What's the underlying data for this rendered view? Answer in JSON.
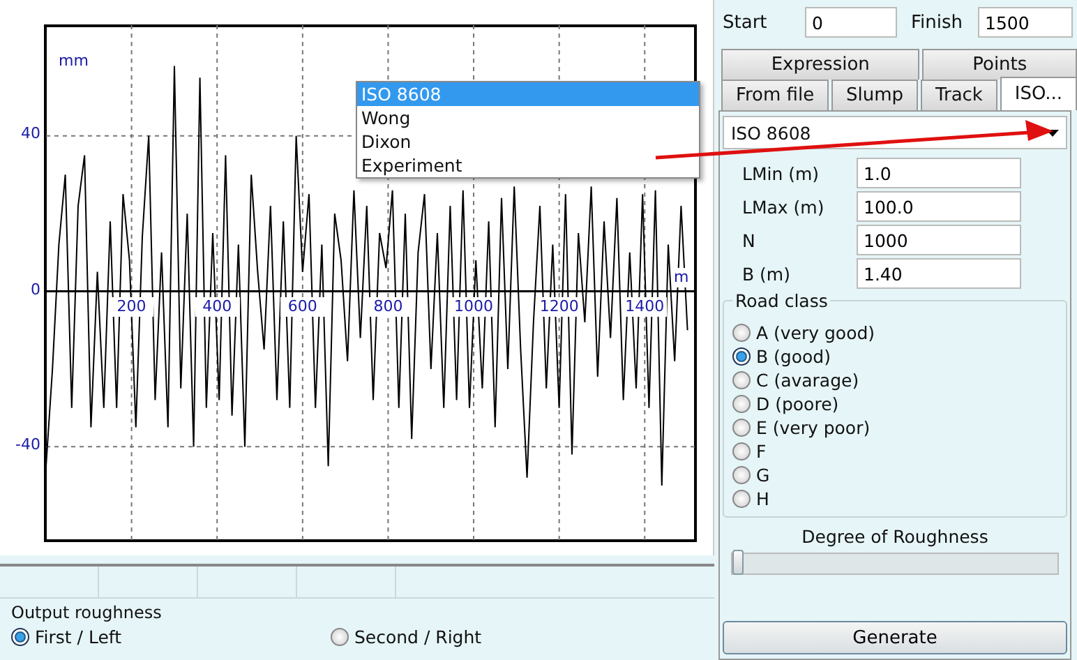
{
  "plot": {
    "chart_data": {
      "type": "line",
      "xlabel": "m",
      "ylabel": "mm",
      "grid": true,
      "xlim": [
        0,
        1517
      ],
      "ylim": [
        -64,
        68.5
      ],
      "xticks": [
        {
          "value": 200,
          "label": "200"
        },
        {
          "value": 400,
          "label": "400"
        },
        {
          "value": 600,
          "label": "600"
        },
        {
          "value": 800,
          "label": "800"
        },
        {
          "value": 1000,
          "label": "1000"
        },
        {
          "value": 1200,
          "label": "1200"
        },
        {
          "value": 1400,
          "label": "1400"
        }
      ],
      "yticks": [
        {
          "value": 40,
          "label": "40"
        },
        {
          "value": 0,
          "label": "0"
        },
        {
          "value": -40,
          "label": "-40"
        }
      ],
      "x": [
        0,
        15,
        30,
        45,
        60,
        75,
        90,
        105,
        120,
        135,
        150,
        165,
        180,
        195,
        210,
        225,
        240,
        255,
        270,
        285,
        300,
        315,
        330,
        345,
        360,
        375,
        390,
        405,
        420,
        435,
        450,
        465,
        480,
        495,
        510,
        525,
        540,
        555,
        570,
        585,
        600,
        615,
        630,
        645,
        660,
        675,
        690,
        705,
        720,
        735,
        750,
        765,
        780,
        795,
        810,
        825,
        840,
        855,
        870,
        885,
        900,
        915,
        930,
        945,
        960,
        975,
        990,
        1005,
        1020,
        1035,
        1050,
        1065,
        1080,
        1095,
        1110,
        1125,
        1140,
        1155,
        1170,
        1185,
        1200,
        1215,
        1230,
        1245,
        1260,
        1275,
        1290,
        1305,
        1320,
        1335,
        1350,
        1365,
        1380,
        1395,
        1410,
        1425,
        1440,
        1455,
        1470,
        1485,
        1500
      ],
      "values": [
        -45,
        -20,
        12,
        30,
        -30,
        22,
        35,
        -35,
        5,
        -30,
        18,
        -30,
        25,
        8,
        -35,
        14,
        40,
        -28,
        10,
        -35,
        58,
        -25,
        20,
        -40,
        55,
        -30,
        15,
        -28,
        35,
        -32,
        12,
        -40,
        30,
        5,
        -15,
        22,
        -28,
        18,
        -30,
        40,
        5,
        25,
        -30,
        12,
        -45,
        20,
        8,
        -18,
        26,
        -12,
        22,
        -28,
        15,
        6,
        26,
        -30,
        20,
        -38,
        10,
        25,
        -20,
        15,
        -30,
        22,
        -28,
        26,
        -30,
        8,
        -25,
        18,
        -35,
        24,
        -20,
        27,
        -15,
        -48,
        -8,
        22,
        -25,
        12,
        -30,
        25,
        -42,
        15,
        -8,
        27,
        -22,
        18,
        -12,
        24,
        -28,
        10,
        -25,
        25,
        -30,
        26,
        -50,
        12,
        -18,
        22,
        -10
      ]
    }
  },
  "output_roughness": {
    "title": "Output roughness",
    "options": [
      {
        "label": "First / Left",
        "selected": true
      },
      {
        "label": "Second / Right",
        "selected": false
      }
    ]
  },
  "range": {
    "start_label": "Start",
    "start": "0",
    "finish_label": "Finish",
    "finish": "1500"
  },
  "tabs": [
    [
      {
        "label": "Expression",
        "selected": false
      },
      {
        "label": "Points",
        "selected": false
      }
    ],
    [
      {
        "label": "From file",
        "selected": false
      },
      {
        "label": "Slump",
        "selected": false
      },
      {
        "label": "Track",
        "selected": false
      },
      {
        "label": "ISO...",
        "selected": true
      }
    ]
  ],
  "method": {
    "value": "ISO 8608",
    "expanded": true,
    "options": [
      {
        "label": "ISO 8608",
        "selected": true
      },
      {
        "label": "Wong",
        "selected": false
      },
      {
        "label": "Dixon",
        "selected": false
      },
      {
        "label": "Experiment",
        "selected": false
      }
    ]
  },
  "fields": [
    {
      "label": "LMin (m)",
      "value": "1.0"
    },
    {
      "label": "LMax (m)",
      "value": "100.0"
    },
    {
      "label": "N",
      "value": "1000"
    },
    {
      "label": "B (m)",
      "value": "1.40"
    }
  ],
  "road_class": {
    "title": "Road class",
    "options": [
      {
        "label": "A (very good)",
        "selected": false
      },
      {
        "label": "B (good)",
        "selected": true
      },
      {
        "label": "C (avarage)",
        "selected": false
      },
      {
        "label": "D (poore)",
        "selected": false
      },
      {
        "label": "E (very poor)",
        "selected": false
      },
      {
        "label": "F",
        "selected": false
      },
      {
        "label": "G",
        "selected": false
      },
      {
        "label": "H",
        "selected": false
      }
    ]
  },
  "roughness": {
    "label": "Degree of Roughness",
    "level": 0
  },
  "generate_button": "Generate"
}
